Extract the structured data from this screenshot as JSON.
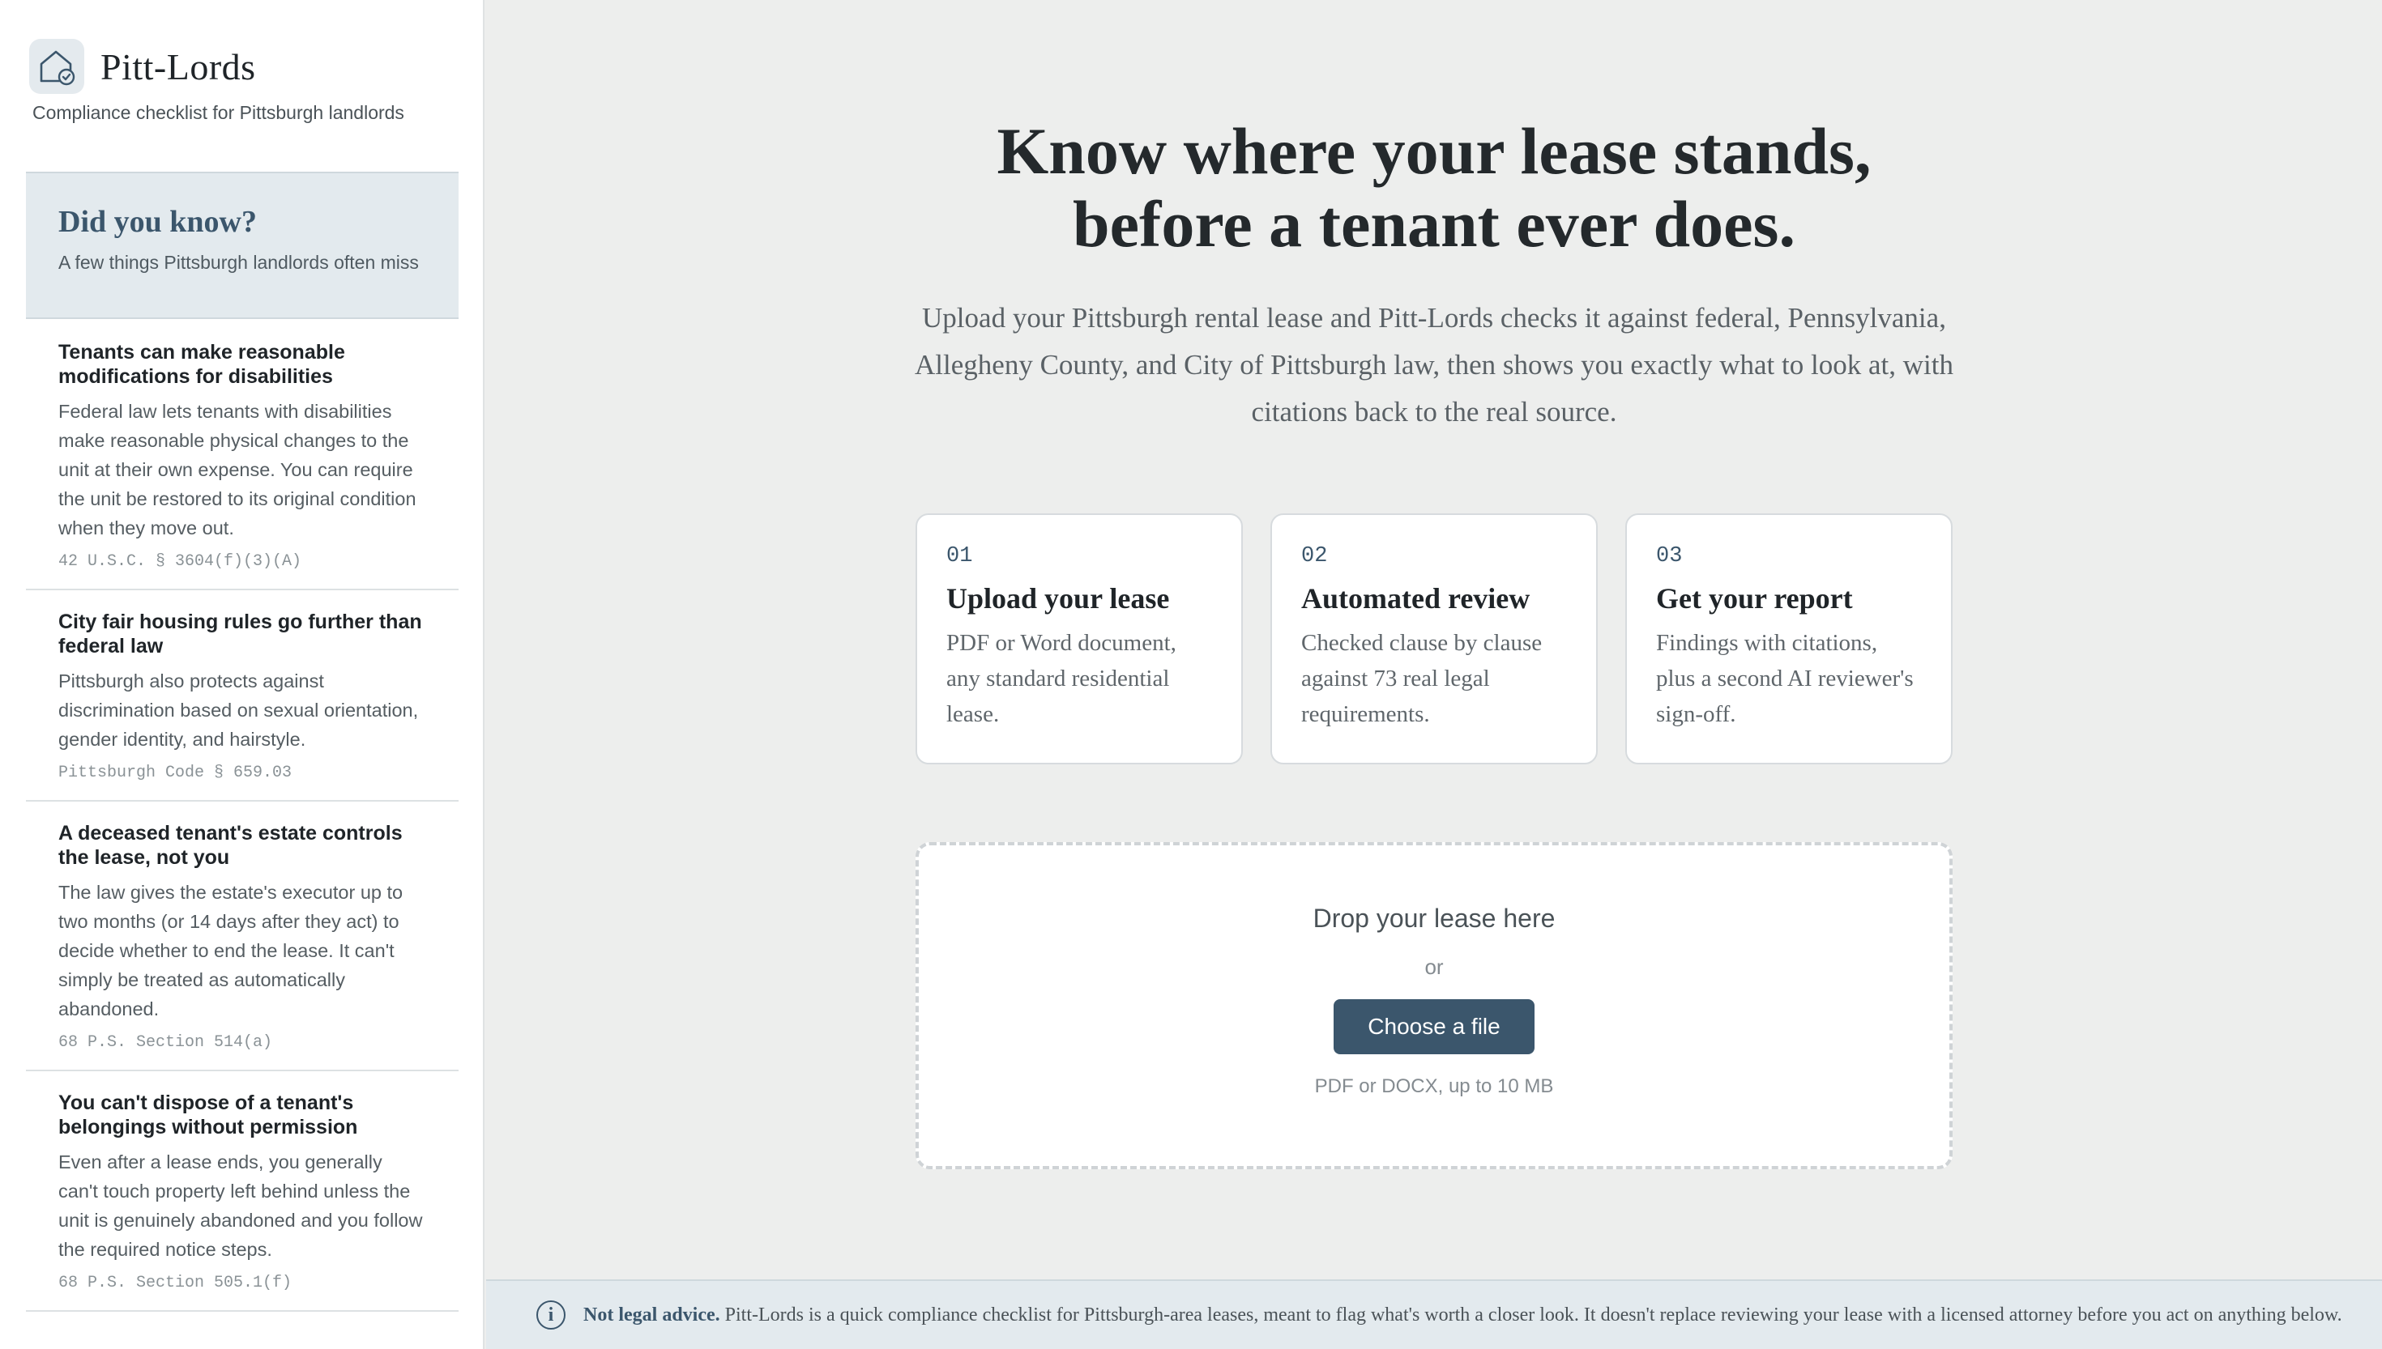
{
  "sidebar": {
    "brand_name": "Pitt-Lords",
    "tagline": "Compliance checklist for Pittsburgh landlords",
    "logo_icon": "house-check-icon",
    "did_you_know": {
      "title": "Did you know?",
      "subtitle": "A few things Pittsburgh landlords often miss"
    },
    "facts": [
      {
        "title": "Tenants can make reasonable modifications for disabilities",
        "body": "Federal law lets tenants with disabilities make reasonable physical changes to the unit at their own expense. You can require the unit be restored to its original condition when they move out.",
        "citation": "42 U.S.C. § 3604(f)(3)(A)"
      },
      {
        "title": "City fair housing rules go further than federal law",
        "body": "Pittsburgh also protects against discrimination based on sexual orientation, gender identity, and hairstyle.",
        "citation": "Pittsburgh Code § 659.03"
      },
      {
        "title": "A deceased tenant's estate controls the lease, not you",
        "body": "The law gives the estate's executor up to two months (or 14 days after they act) to decide whether to end the lease. It can't simply be treated as automatically abandoned.",
        "citation": "68 P.S. Section 514(a)"
      },
      {
        "title": "You can't dispose of a tenant's belongings without permission",
        "body": "Even after a lease ends, you generally can't touch property left behind unless the unit is genuinely abandoned and you follow the required notice steps.",
        "citation": "68 P.S. Section 505.1(f)"
      }
    ]
  },
  "main": {
    "hero_line1": "Know where your lease stands,",
    "hero_line2": "before a tenant ever does.",
    "lede": "Upload your Pittsburgh rental lease and Pitt-Lords checks it against federal, Pennsylvania, Allegheny County, and City of Pittsburgh law, then shows you exactly what to look at, with citations back to the real source.",
    "steps": [
      {
        "num": "01",
        "title": "Upload your lease",
        "body": "PDF or Word document, any standard residential lease."
      },
      {
        "num": "02",
        "title": "Automated review",
        "body": "Checked clause by clause against 73 real legal requirements."
      },
      {
        "num": "03",
        "title": "Get your report",
        "body": "Findings with citations, plus a second AI reviewer's sign-off."
      }
    ],
    "upload": {
      "title": "Drop your lease here",
      "or": "or",
      "button": "Choose a file",
      "hint": "PDF or DOCX, up to 10 MB"
    }
  },
  "footer": {
    "icon": "info-icon",
    "label": "Not legal advice.",
    "text": "Pitt-Lords is a quick compliance checklist for Pittsburgh-area leases, meant to flag what's worth a closer look. It doesn't replace reviewing your lease with a licensed attorney before you act on anything below."
  },
  "colors": {
    "accent": "#3b566c",
    "panel_tint": "#e3eaee",
    "background": "#edeeed"
  }
}
